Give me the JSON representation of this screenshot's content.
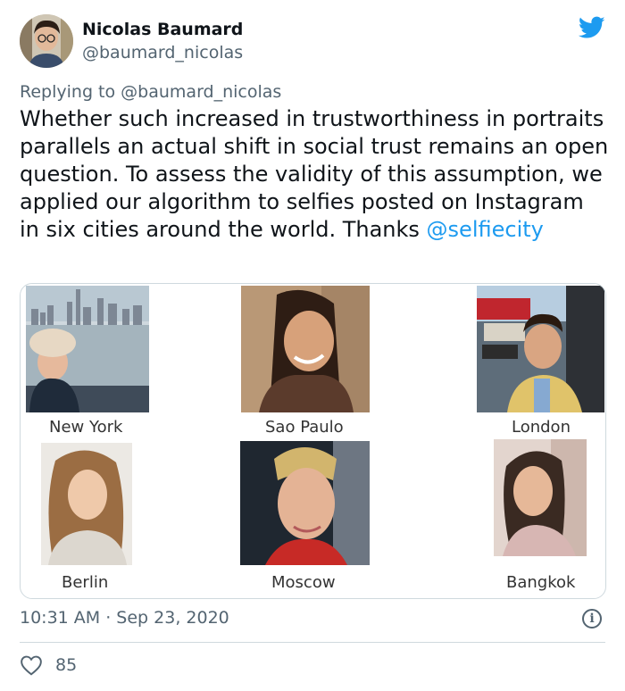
{
  "author": {
    "name": "Nicolas Baumard",
    "handle": "@baumard_nicolas"
  },
  "reply": {
    "prefix": "Replying to",
    "mention": "@baumard_nicolas"
  },
  "tweet": {
    "text": "Whether such increased in trustworthiness in portraits parallels an actual shift in social trust remains an open question. To assess the validity of this assumption, we applied our algorithm to selfies posted on Instagram in six cities around the world. Thanks ",
    "link": "@selfiecity"
  },
  "media": {
    "cities": [
      "New York",
      "Sao Paulo",
      "London",
      "Berlin",
      "Moscow",
      "Bangkok"
    ]
  },
  "meta": {
    "timestamp": "10:31 AM · Sep 23, 2020",
    "likes": "85"
  },
  "icons": {
    "brand": "twitter-bird-icon",
    "info": "info-icon",
    "like": "heart-icon"
  },
  "colors": {
    "link": "#1d9bf0",
    "secondary_text": "#536471",
    "border": "#cfd9de"
  }
}
